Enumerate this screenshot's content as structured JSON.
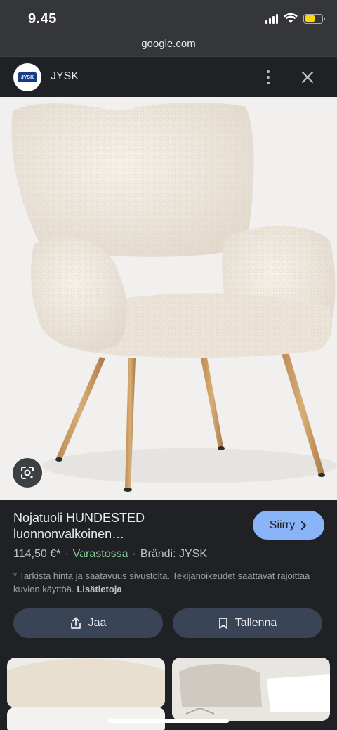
{
  "status_bar": {
    "time": "9.45",
    "battery_color": "#ffd60a"
  },
  "browser": {
    "url": "google.com"
  },
  "site": {
    "name": "JYSK",
    "logo_text": "JYSK"
  },
  "product": {
    "title_line1": "Nojatuoli HUNDESTED",
    "title_line2": "luonnonvalkoinen…",
    "price": "114,50 €*",
    "stock": "Varastossa",
    "brand": "Brändi: JYSK",
    "disclaimer": "* Tarkista hinta ja saatavuus sivustolta. Tekijänoikeudet saattavat rajoittaa kuvien käyttöä.",
    "more_link": "Lisätietoja"
  },
  "actions": {
    "go_label": "Siirry",
    "share_label": "Jaa",
    "save_label": "Tallenna",
    "go_color": "#8ab4f8"
  },
  "icons": [
    "lens-icon",
    "share-icon",
    "bookmark-icon",
    "more-vert-icon",
    "close-icon",
    "chevron-right-icon",
    "wifi-icon",
    "signal-icon",
    "battery-icon"
  ]
}
